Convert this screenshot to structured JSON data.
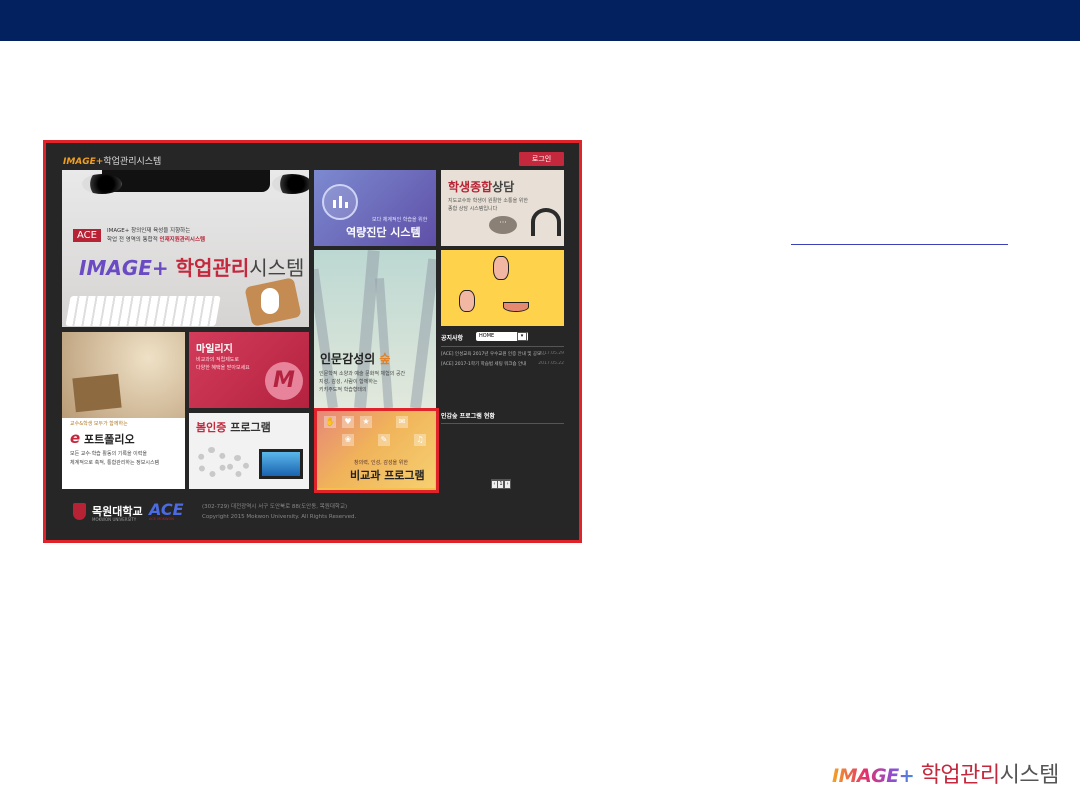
{
  "colors": {
    "topbar": "#03205f",
    "highlight": "#e0222b",
    "brand_red": "#c4283d"
  },
  "screenshot": {
    "logo": {
      "prefix": "IMAGE+",
      "name": "학업관리시스템"
    },
    "login_button": "로그인",
    "hero": {
      "ace_tag": "ACE",
      "sub_line1": "IMAGE+ 창의인재 육성을 지향하는",
      "sub_line2": "학업 전 영역의 통합적",
      "sub_line2_bold": "인재지원관리시스템",
      "title_prefix": "IMAGE+",
      "title_red": "학업관리",
      "title_gray": "시스템"
    },
    "yeok": {
      "sub": "보다 체계적인 학습을 위한",
      "title": "역량진단 시스템"
    },
    "sang": {
      "title_red": "학생종합",
      "title_gray": "상담",
      "desc1": "지도교수와 학생이 원활한 소통을 위한",
      "desc2": "종합 상담 시스템입니다",
      "bubble": "···"
    },
    "forest": {
      "title_main": "인문감성의",
      "title_accent": "숲",
      "desc1": "인문학적 소양과 예술 문화적 체험의 공간",
      "desc2": "지성, 감성, 사람이 함께하는",
      "desc3": "키키주도적 학습형태의"
    },
    "notice": {
      "heading": "공지사항",
      "select_value": "HOME",
      "items": [
        {
          "text": "[ACE] 인성교육 2017년 우수교원 인증 안내 및 공모...",
          "date": "2017.05.29"
        },
        {
          "text": "[ACE] 2017-1학기 학습법 세팅 워크숍 안내",
          "date": "2017.05.22"
        }
      ],
      "program_heading": "인감숲 프로그램 현황"
    },
    "pager": {
      "current": "1"
    },
    "portfolio": {
      "small": "교수&학생 모두가 함께하는",
      "title_e": "e",
      "title": " 포트폴리오",
      "desc1": "모든 교수·학습 활동의 기록을 이력을",
      "desc2": "체계적으로 축적, 통합관리하는 정보시스템"
    },
    "mileage": {
      "title": "마일리지",
      "desc1": "비교과의 적립제도로",
      "desc2": "다양한 혜택을 받아보세요",
      "badge": "M"
    },
    "bom": {
      "title_red": "봄인증",
      "title_gray": " 프로그램"
    },
    "bigyo": {
      "sub": "창의력, 인성, 감성을 위한",
      "title": "비교과 프로그램"
    },
    "footer": {
      "univ": "목원대학교",
      "univ_en": "MOKWON UNIVERSITY",
      "ace": "ACE",
      "ace_sub": "ACE MOKWON",
      "address": "(302-729) 대전광역시 서구 도안북로 88(도안동, 목원대학교)",
      "copyright": "Copyright 2015 Mokwon University. All Rights Reserved."
    }
  },
  "brand": {
    "prefix": "IMAGE+",
    "red": "학업관리",
    "gray": "시스템"
  }
}
